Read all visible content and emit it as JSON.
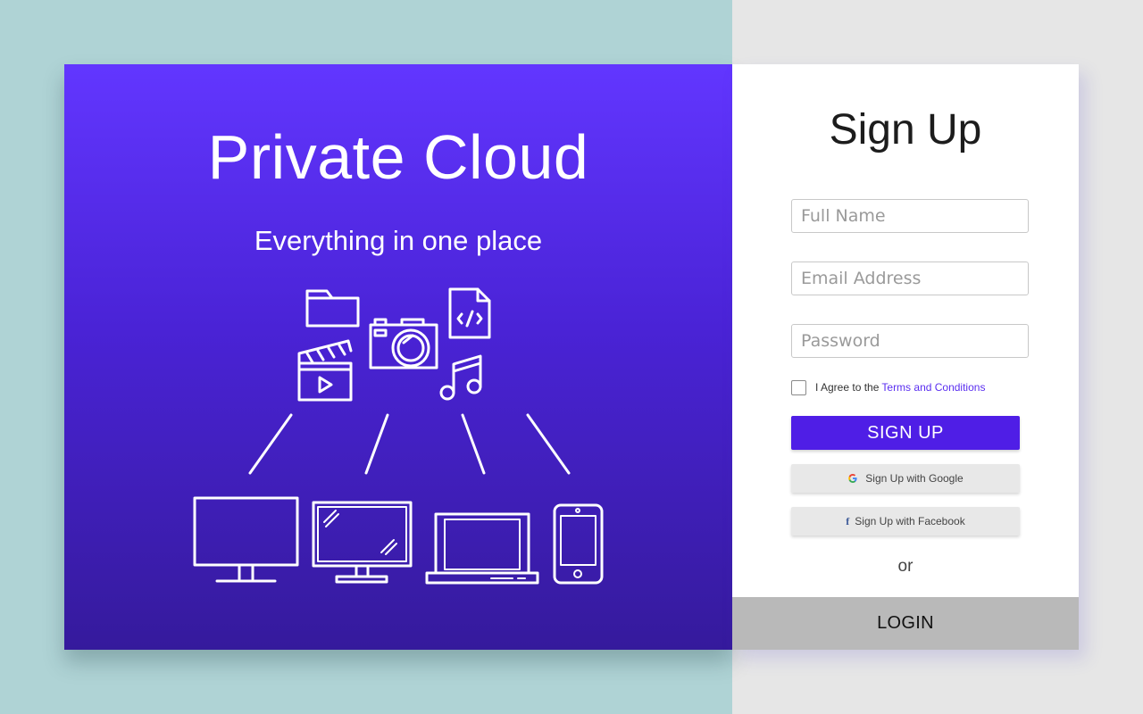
{
  "hero": {
    "title": "Private Cloud",
    "subtitle": "Everything in one place",
    "icons": [
      "folder-icon",
      "camera-icon",
      "code-file-icon",
      "video-clapper-icon",
      "music-note-icon",
      "monitor-icon",
      "all-in-one-computer-icon",
      "laptop-icon",
      "smartphone-icon"
    ],
    "colors": {
      "gradient_top": "#6236ff",
      "gradient_bottom": "#351a9c"
    }
  },
  "signup": {
    "title": "Sign Up",
    "fields": {
      "full_name": {
        "placeholder": "Full Name",
        "value": ""
      },
      "email": {
        "placeholder": "Email Address",
        "value": ""
      },
      "password": {
        "placeholder": "Password",
        "value": ""
      }
    },
    "terms": {
      "checked": false,
      "text": "I Agree to the",
      "link": "Terms and Conditions"
    },
    "signup_button": "SIGN UP",
    "google_button": "Sign Up with Google",
    "facebook_button": "Sign Up with Facebook",
    "or_text": "or",
    "login_button": "LOGIN",
    "colors": {
      "primary": "#4f1ee6",
      "link": "#5a2ef0"
    }
  }
}
